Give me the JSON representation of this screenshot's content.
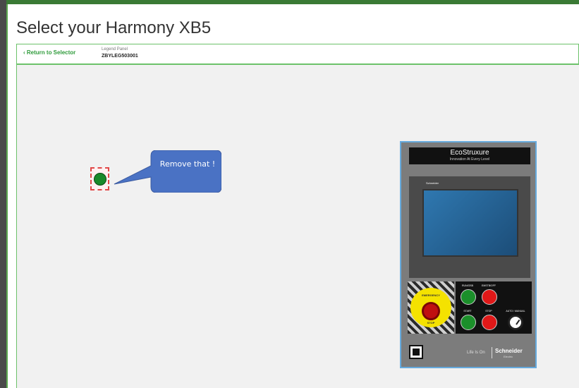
{
  "page_title": "Select your Harmony XB5",
  "header": {
    "return_label": "Return to Selector",
    "legend_label": "Legend Panel",
    "legend_code": "ZBYLEG503001"
  },
  "callout": {
    "text": "Remove that !"
  },
  "panel": {
    "eco_title": "EcoStruxure",
    "eco_subtitle": "Innovation At Every Level",
    "hmi_brand": "Schneider",
    "estop_top_text": "EMERGENCY",
    "estop_bottom_text": "STOP",
    "controls": {
      "label_1": "RUN/OSB",
      "label_2": "EMSTB/OFF",
      "label_3": "START",
      "label_4": "STOP",
      "label_5": "AUTO / MANUAL"
    },
    "footer_lifeison": "Life Is On",
    "footer_brand": "Schneider",
    "footer_brand_sub": "Electric"
  },
  "colors": {
    "accent_green": "#6cc26a",
    "link_green": "#2e9b3a",
    "callout_blue": "#4a72c4"
  }
}
